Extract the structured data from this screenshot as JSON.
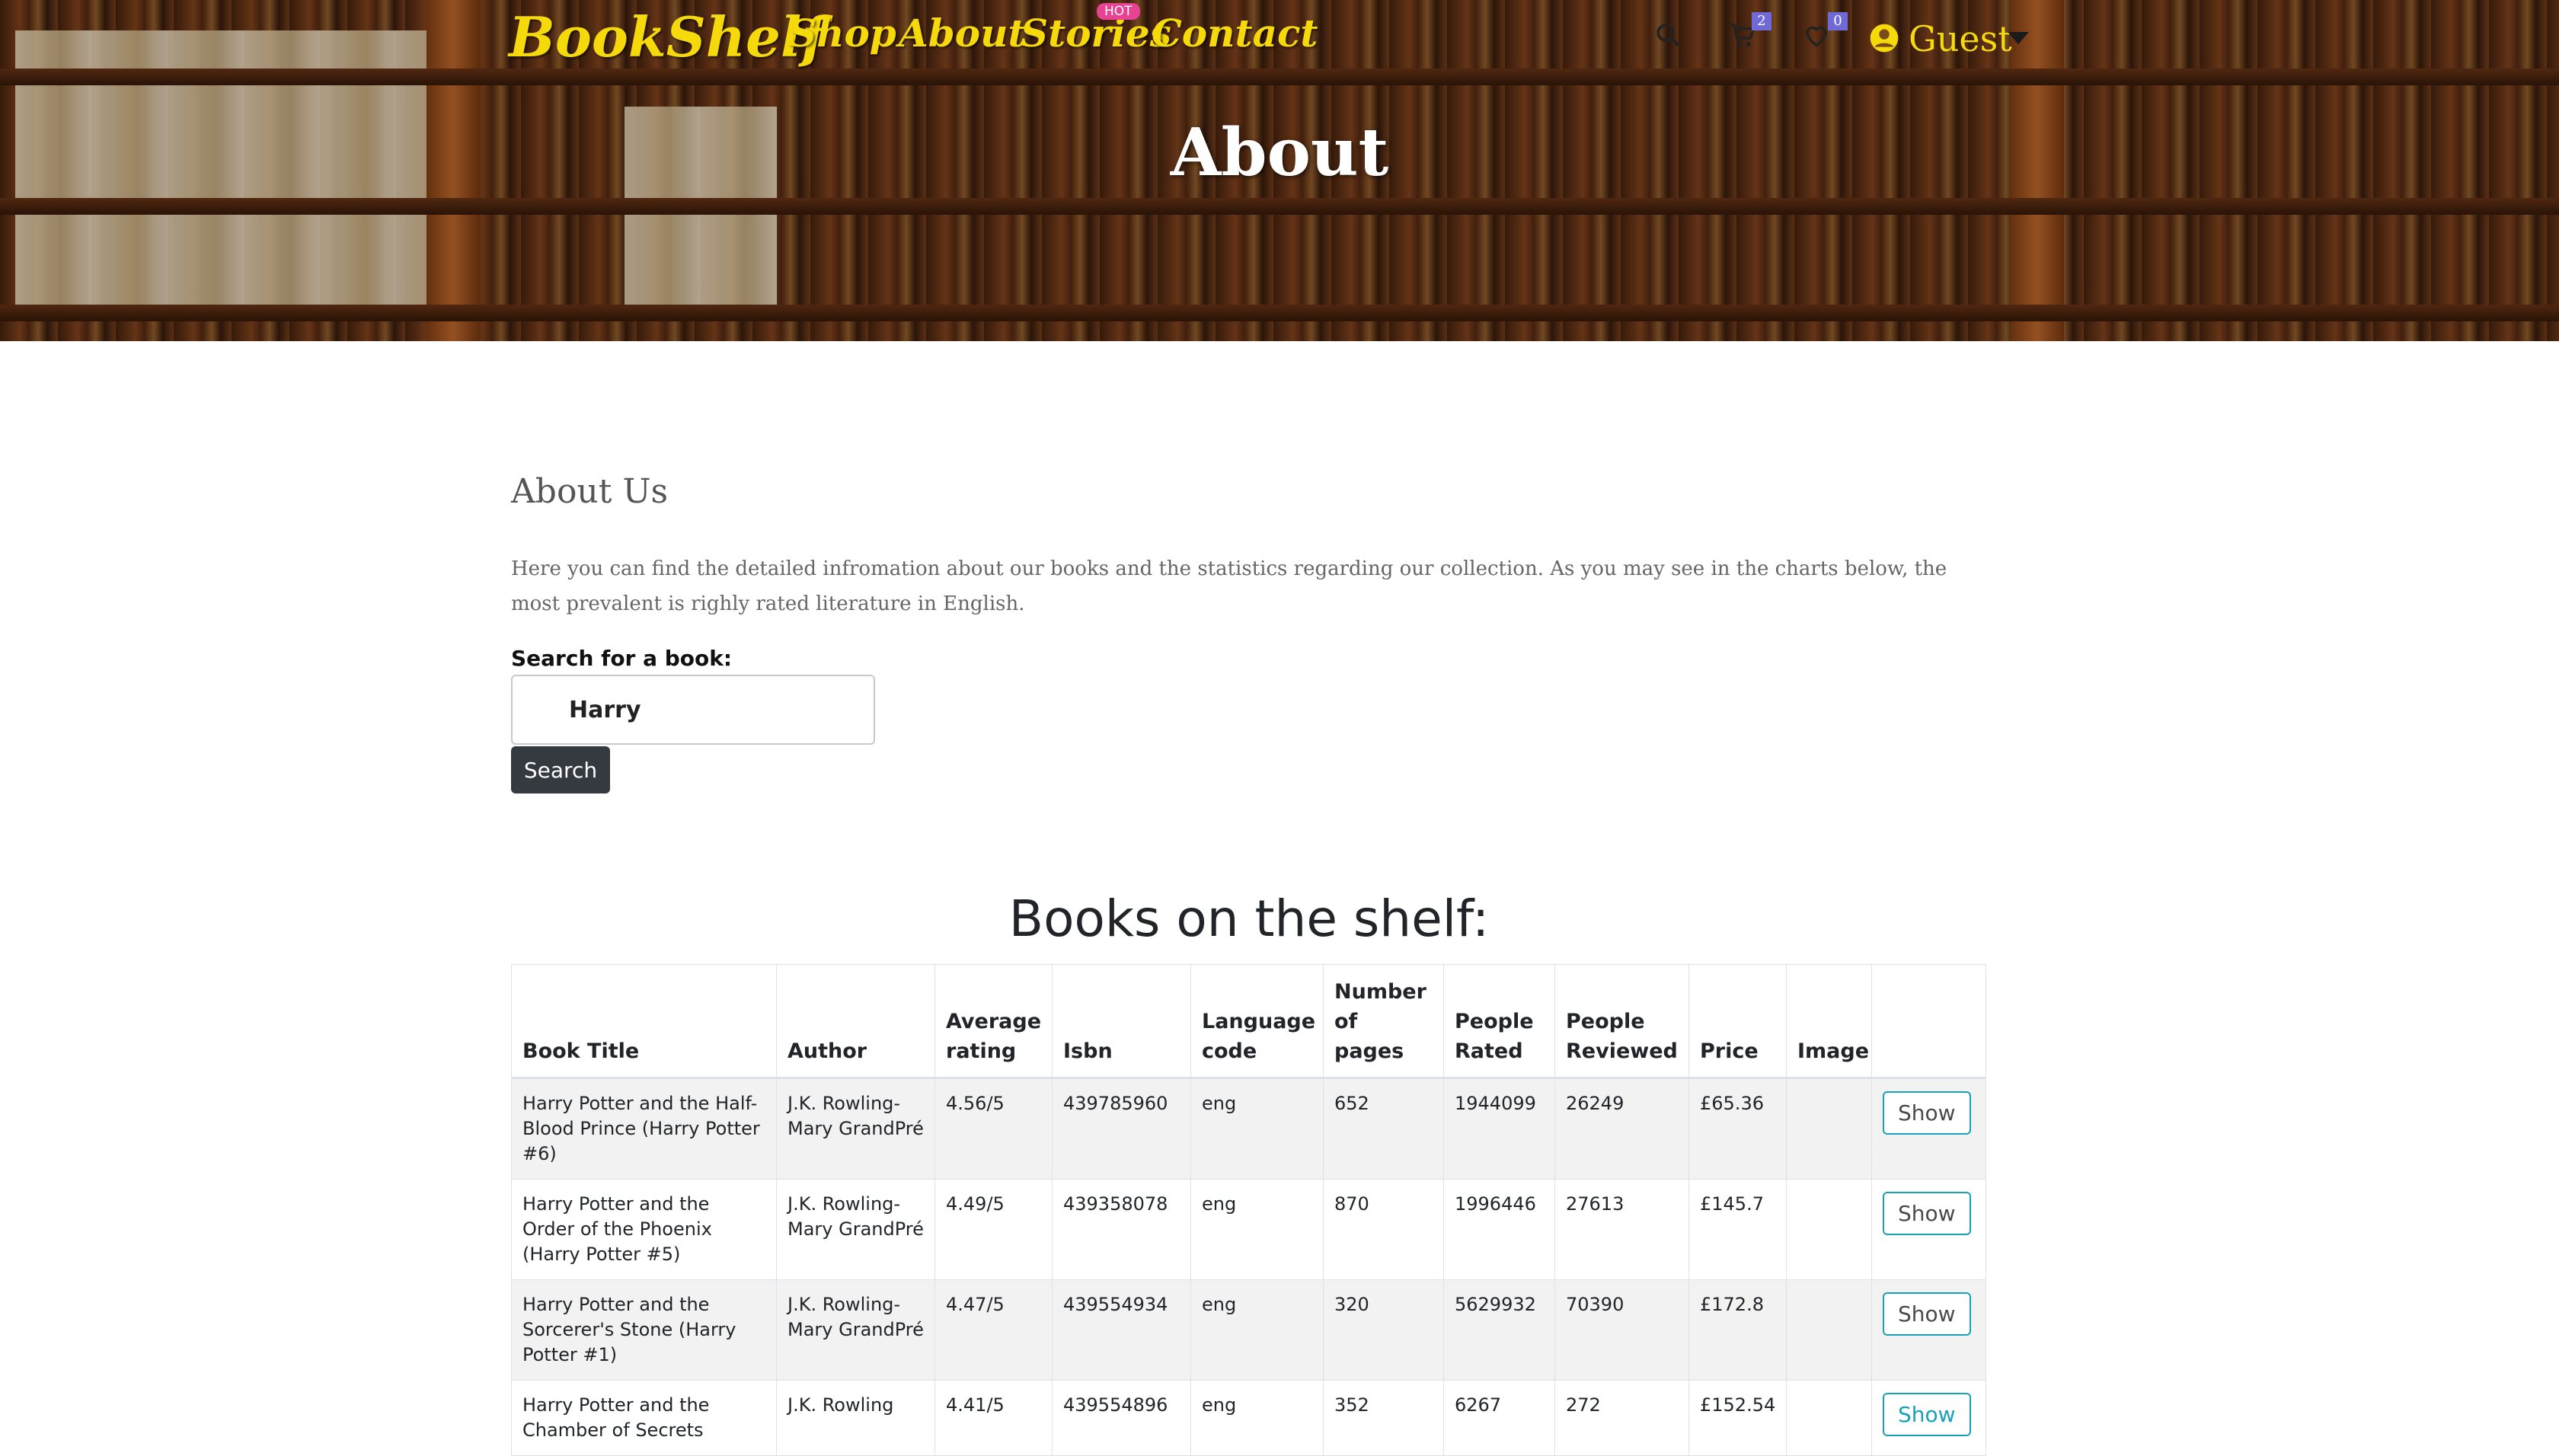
{
  "header": {
    "logo": "BookShelf",
    "nav": [
      "Shop",
      "About",
      "Stories",
      "Contact"
    ],
    "hot_badge": "HOT",
    "cart_count": "2",
    "wishlist_count": "0",
    "user": "Guest",
    "hero_title": "About",
    "icons": [
      "search-icon",
      "cart-icon",
      "heart-icon",
      "user-circle-icon",
      "caret-down-icon"
    ]
  },
  "about": {
    "heading": "About Us",
    "paragraph": "Here you can find the detailed infromation about our books and the statistics regarding our collection. As you may see in the charts below, the most prevalent is righly rated literature in English."
  },
  "search": {
    "label": "Search for a book:",
    "value": "Harry",
    "button": "Search"
  },
  "books": {
    "heading": "Books on the shelf:",
    "columns": [
      "Book Title",
      "Author",
      "Average rating",
      "Isbn",
      "Language code",
      "Number of pages",
      "People Rated",
      "People Reviewed",
      "Price",
      "Image",
      ""
    ],
    "rows": [
      {
        "title": "Harry Potter and the Half-Blood Prince (Harry Potter #6)",
        "author": "J.K. Rowling-Mary GrandPré",
        "rating": "4.56/5",
        "isbn": "439785960",
        "lang": "eng",
        "pages": "652",
        "rated": "1944099",
        "reviewed": "26249",
        "price": "£65.36",
        "image": "",
        "action": "Show"
      },
      {
        "title": "Harry Potter and the Order of the Phoenix (Harry Potter #5)",
        "author": "J.K. Rowling-Mary GrandPré",
        "rating": "4.49/5",
        "isbn": "439358078",
        "lang": "eng",
        "pages": "870",
        "rated": "1996446",
        "reviewed": "27613",
        "price": "£145.7",
        "image": "",
        "action": "Show"
      },
      {
        "title": "Harry Potter and the Sorcerer's Stone (Harry Potter #1)",
        "author": "J.K. Rowling-Mary GrandPré",
        "rating": "4.47/5",
        "isbn": "439554934",
        "lang": "eng",
        "pages": "320",
        "rated": "5629932",
        "reviewed": "70390",
        "price": "£172.8",
        "image": "",
        "action": "Show"
      },
      {
        "title": "Harry Potter and the Chamber of Secrets",
        "author": "J.K. Rowling",
        "rating": "4.41/5",
        "isbn": "439554896",
        "lang": "eng",
        "pages": "352",
        "rated": "6267",
        "reviewed": "272",
        "price": "£152.54",
        "image": "",
        "action": "Show"
      }
    ]
  }
}
